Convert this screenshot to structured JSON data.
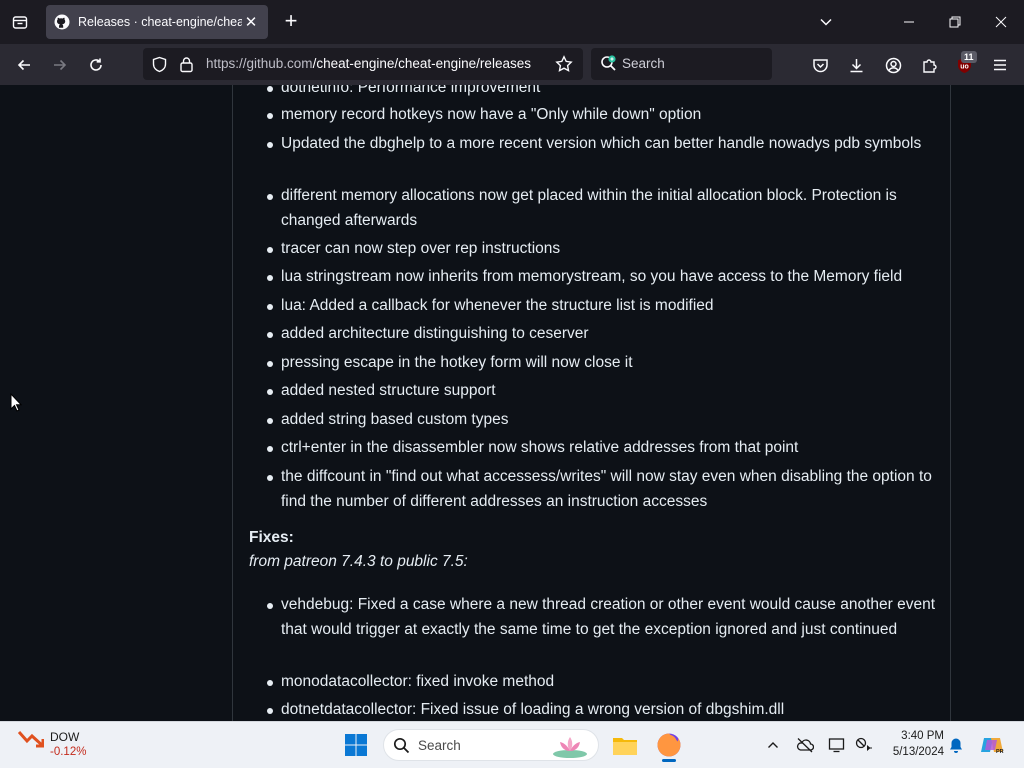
{
  "browser": {
    "tab_title": "Releases · cheat-engine/cheat-engine",
    "url_host": "https://github.com",
    "url_path": "/cheat-engine/cheat-engine/releases",
    "search_placeholder": "Search",
    "extension_badge": "11"
  },
  "content": {
    "items_top": [
      "dotnetinfo: Performance improvement",
      "memory record hotkeys now have a \"Only while down\" option",
      "Updated the dbghelp to a more recent version which can better handle nowadys pdb symbols",
      "different memory allocations now get placed within the initial allocation block. Protection is changed afterwards",
      "tracer can now step over rep instructions",
      "lua stringstream now inherits from memorystream, so you have access to the Memory field",
      "lua: Added a callback for whenever the structure list is modified",
      "added architecture distinguishing to ceserver",
      "pressing escape in the hotkey form will now close it",
      "added nested structure support",
      "added string based custom types",
      "ctrl+enter in the disassembler now shows relative addresses from that point",
      "the diffcount in \"find out what accessess/writes\" will now stay even when disabling the option to find the number of different addresses an instruction accesses"
    ],
    "fixes_heading": "Fixes:",
    "fixes_subheading": "from patreon 7.4.3 to public 7.5:",
    "items_fixes": [
      "vehdebug: Fixed a case where a new thread creation or other event would cause another event that would trigger at exactly the same time to get the exception ignored and just continued",
      "monodatacollector: fixed invoke method",
      "dotnetdatacollector: Fixed issue of loading a wrong version of dbgshim.dll"
    ]
  },
  "taskbar": {
    "stock_name": "DOW",
    "stock_change": "-0.12%",
    "search_label": "Search",
    "time": "3:40 PM",
    "date": "5/13/2024"
  },
  "colors": {
    "page_bg": "#0d1117",
    "text": "#e6edf3",
    "chrome_dark": "#1c1b22",
    "chrome_mid": "#2b2a33",
    "stock_negative": "#c42b1c"
  }
}
